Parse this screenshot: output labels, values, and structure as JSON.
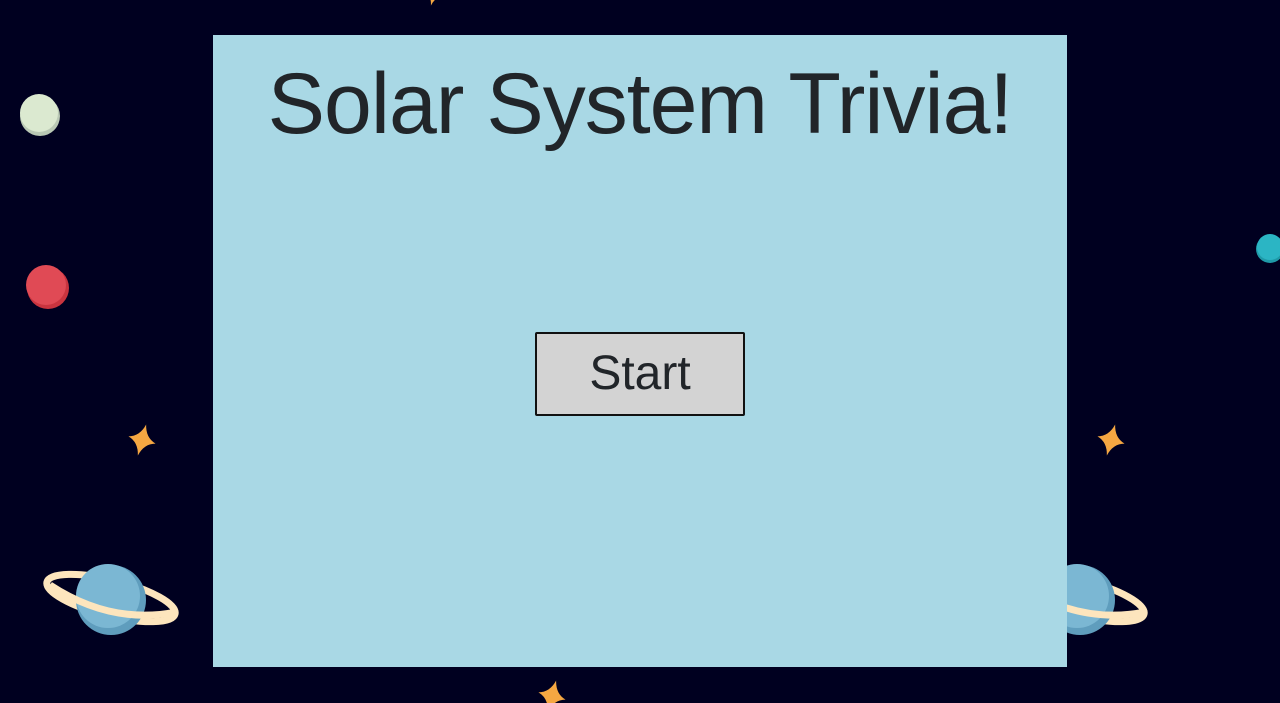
{
  "game": {
    "title": "Solar System Trivia!",
    "start_label": "Start"
  },
  "colors": {
    "background": "#000020",
    "panel": "#a9d8e5",
    "button": "#d3d3d3",
    "text": "#212529",
    "star": "#f5a742",
    "planet_green": "#dbe9d0",
    "planet_red": "#e04a55",
    "planet_teal": "#2bb5c4",
    "planet_blue": "#7bb7d3",
    "ring": "#fde5bd"
  },
  "decorations": {
    "icons": [
      "star-icon",
      "planet-icon",
      "ringed-planet-icon"
    ]
  }
}
